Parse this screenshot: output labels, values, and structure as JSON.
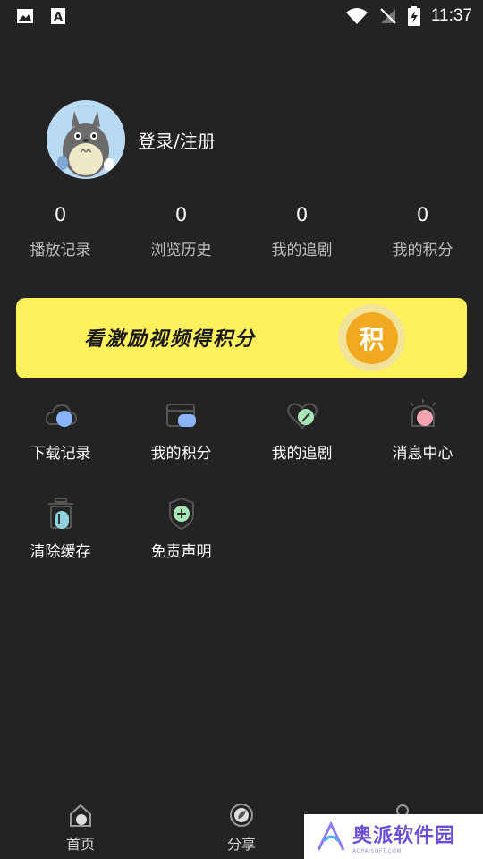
{
  "status_bar": {
    "time": "11:37"
  },
  "profile": {
    "login_label": "登录/注册"
  },
  "stats": [
    {
      "value": "0",
      "label": "播放记录"
    },
    {
      "value": "0",
      "label": "浏览历史"
    },
    {
      "value": "0",
      "label": "我的追剧"
    },
    {
      "value": "0",
      "label": "我的积分"
    }
  ],
  "banner": {
    "text": "看激励视频得积分",
    "coin_label": "积"
  },
  "menu": [
    {
      "label": "下载记录",
      "icon": "cloud-download-icon"
    },
    {
      "label": "我的积分",
      "icon": "card-icon"
    },
    {
      "label": "我的追剧",
      "icon": "heart-icon"
    },
    {
      "label": "消息中心",
      "icon": "bell-icon"
    },
    {
      "label": "清除缓存",
      "icon": "trash-icon"
    },
    {
      "label": "免责声明",
      "icon": "shield-plus-icon"
    }
  ],
  "bottom_nav": [
    {
      "label": "首页",
      "icon": "home-icon"
    },
    {
      "label": "分享",
      "icon": "compass-icon"
    },
    {
      "label": "",
      "icon": "profile-icon"
    }
  ],
  "watermark": {
    "title": "奥派软件园",
    "subtitle": "AOPAISOFT.COM"
  },
  "colors": {
    "background": "#232323",
    "banner": "#fef15b",
    "coin": "#f3a91f",
    "accent_blue": "#8ab4f8",
    "accent_pink": "#f4a3b0",
    "accent_green": "#a8e6b8"
  }
}
